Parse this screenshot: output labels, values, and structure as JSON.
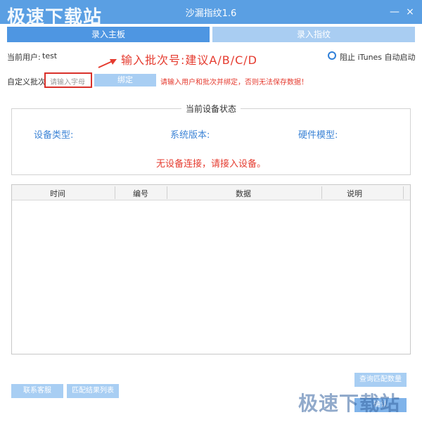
{
  "watermark_text": "极速下载站",
  "window": {
    "title": "沙漏指纹1.6",
    "minimize_glyph": "—",
    "close_glyph": "×"
  },
  "tabs": [
    {
      "label": "录入主板",
      "active": true
    },
    {
      "label": "录入指纹",
      "active": false
    }
  ],
  "user": {
    "label": "当前用户:",
    "name": "test"
  },
  "callout": {
    "text": "输入批次号:建议A/B/C/D"
  },
  "itunes": {
    "label": "阻止 iTunes 自动启动",
    "checked": false
  },
  "batch": {
    "label": "自定义批次",
    "placeholder": "请输入字母",
    "bind_label": "绑定",
    "warning": "请输入用户和批次并绑定，否则无法保存数据！"
  },
  "device_status": {
    "title": "当前设备状态",
    "type_label": "设备类型:",
    "version_label": "系统版本:",
    "hardware_label": "硬件模型:",
    "message": "无设备连接，请接入设备。"
  },
  "table": {
    "columns": [
      "时间",
      "编号",
      "数据",
      "说明"
    ],
    "rows": []
  },
  "buttons": {
    "query": "查询匹配数量",
    "contact": "联系客服",
    "match_list": "匹配结果列表",
    "confirm": "确认"
  },
  "colors": {
    "titlebar": "#5a9fe3",
    "active_tab": "#4e96e2",
    "inactive_tab": "#a9cdf2",
    "button": "#a8cef3",
    "warning_red": "#e53b2f",
    "label_blue": "#3d84d6"
  }
}
